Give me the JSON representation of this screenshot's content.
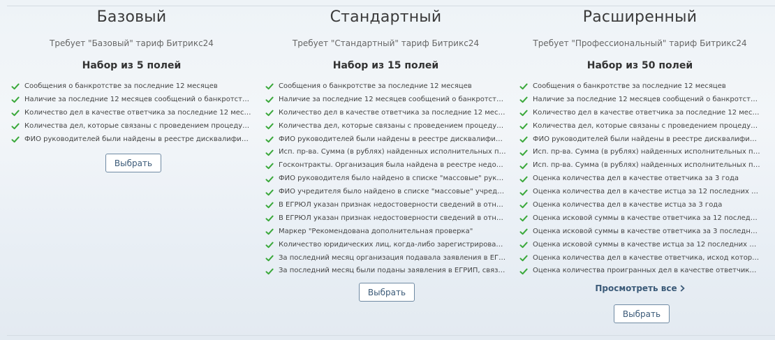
{
  "colors": {
    "check": "#3aa83a",
    "button_border": "#6f8aa3",
    "link": "#3b5a78"
  },
  "icons": {
    "check": "check-icon",
    "chevron": "chevron-right-icon"
  },
  "plans": [
    {
      "title": "Базовый",
      "requirement": "Требует \"Базовый\" тариф Битрикс24",
      "count": "Набор из 5 полей",
      "features": [
        "Сообщения о банкротстве за последние 12 месяцев",
        "Наличие за последние 12 месяцев сообщений о банкротстве ф...",
        "Количество дел в качестве ответчика за последние 12 месяцев",
        "Количества дел, которые связаны с проведением процедуры б...",
        "ФИО руководителей были найдены в реестре дисквалифициро..."
      ],
      "button": "Выбрать"
    },
    {
      "title": "Стандартный",
      "requirement": "Требует \"Стандартный\" тариф Битрикс24",
      "count": "Набор из 15 полей",
      "features": [
        "Сообщения о банкротстве за последние 12 месяцев",
        "Наличие за последние 12 месяцев сообщений о банкротстве ф...",
        "Количество дел в качестве ответчика за последние 12 месяцев",
        "Количества дел, которые связаны с проведением процедуры б...",
        "ФИО руководителей были найдены в реестре дисквалифициро...",
        "Исп. пр-ва. Сумма (в рублях) найденных исполнительных произ...",
        "Госконтракты. Организация была найдена в реестре недоброс...",
        "ФИО руководителя было найдено в списке \"массовые\" руководи...",
        "ФИО учредителя было найдено в списке \"массовые\" учредител...",
        "В ЕГРЮЛ указан признак недостоверности сведений в отношен...",
        "В ЕГРЮЛ указан признак недостоверности сведений в отношен...",
        "Маркер \"Рекомендована дополнительная проверка\"",
        "Количество юридических лиц, когда-либо зарегистрированных...",
        "За последний месяц организация подавала заявления в ЕГРЮЛ...",
        "За последний месяц были поданы заявления в ЕГРИП, связанн..."
      ],
      "button": "Выбрать"
    },
    {
      "title": "Расширенный",
      "requirement": "Требует \"Профессиональный\" тариф Битрикс24",
      "count": "Набор из 50 полей",
      "features": [
        "Сообщения о банкротстве за последние 12 месяцев",
        "Наличие за последние 12 месяцев сообщений о банкротстве ф...",
        "Количество дел в качестве ответчика за последние 12 месяцев",
        "Количества дел, которые связаны с проведением процедуры б...",
        "ФИО руководителей были найдены в реестре дисквалифициро...",
        "Исп. пр-ва. Сумма (в рублях) найденных исполнительных произ...",
        "Исп. пр-ва. Сумма (в рублях) найденных исполнительных произ...",
        "Оценка количества дел в качестве ответчика за 3 года",
        "Оценка количества дел в качестве истца за 12 последних месяц...",
        "Оценка количества дел в качестве истца за 3 года",
        "Оценка исковой суммы в качестве ответчика за 12 последних м...",
        "Оценка исковой суммы в качестве ответчика за 3 последних го...",
        "Оценка исковой суммы в качестве истца за 12 последних месяц...",
        "Оценка количества дел в качестве ответчика, исход которых оп...",
        "Оценка количества проигранных дел в качестве ответчика (за ..."
      ],
      "view_all": "Просмотреть все",
      "button": "Выбрать"
    }
  ]
}
